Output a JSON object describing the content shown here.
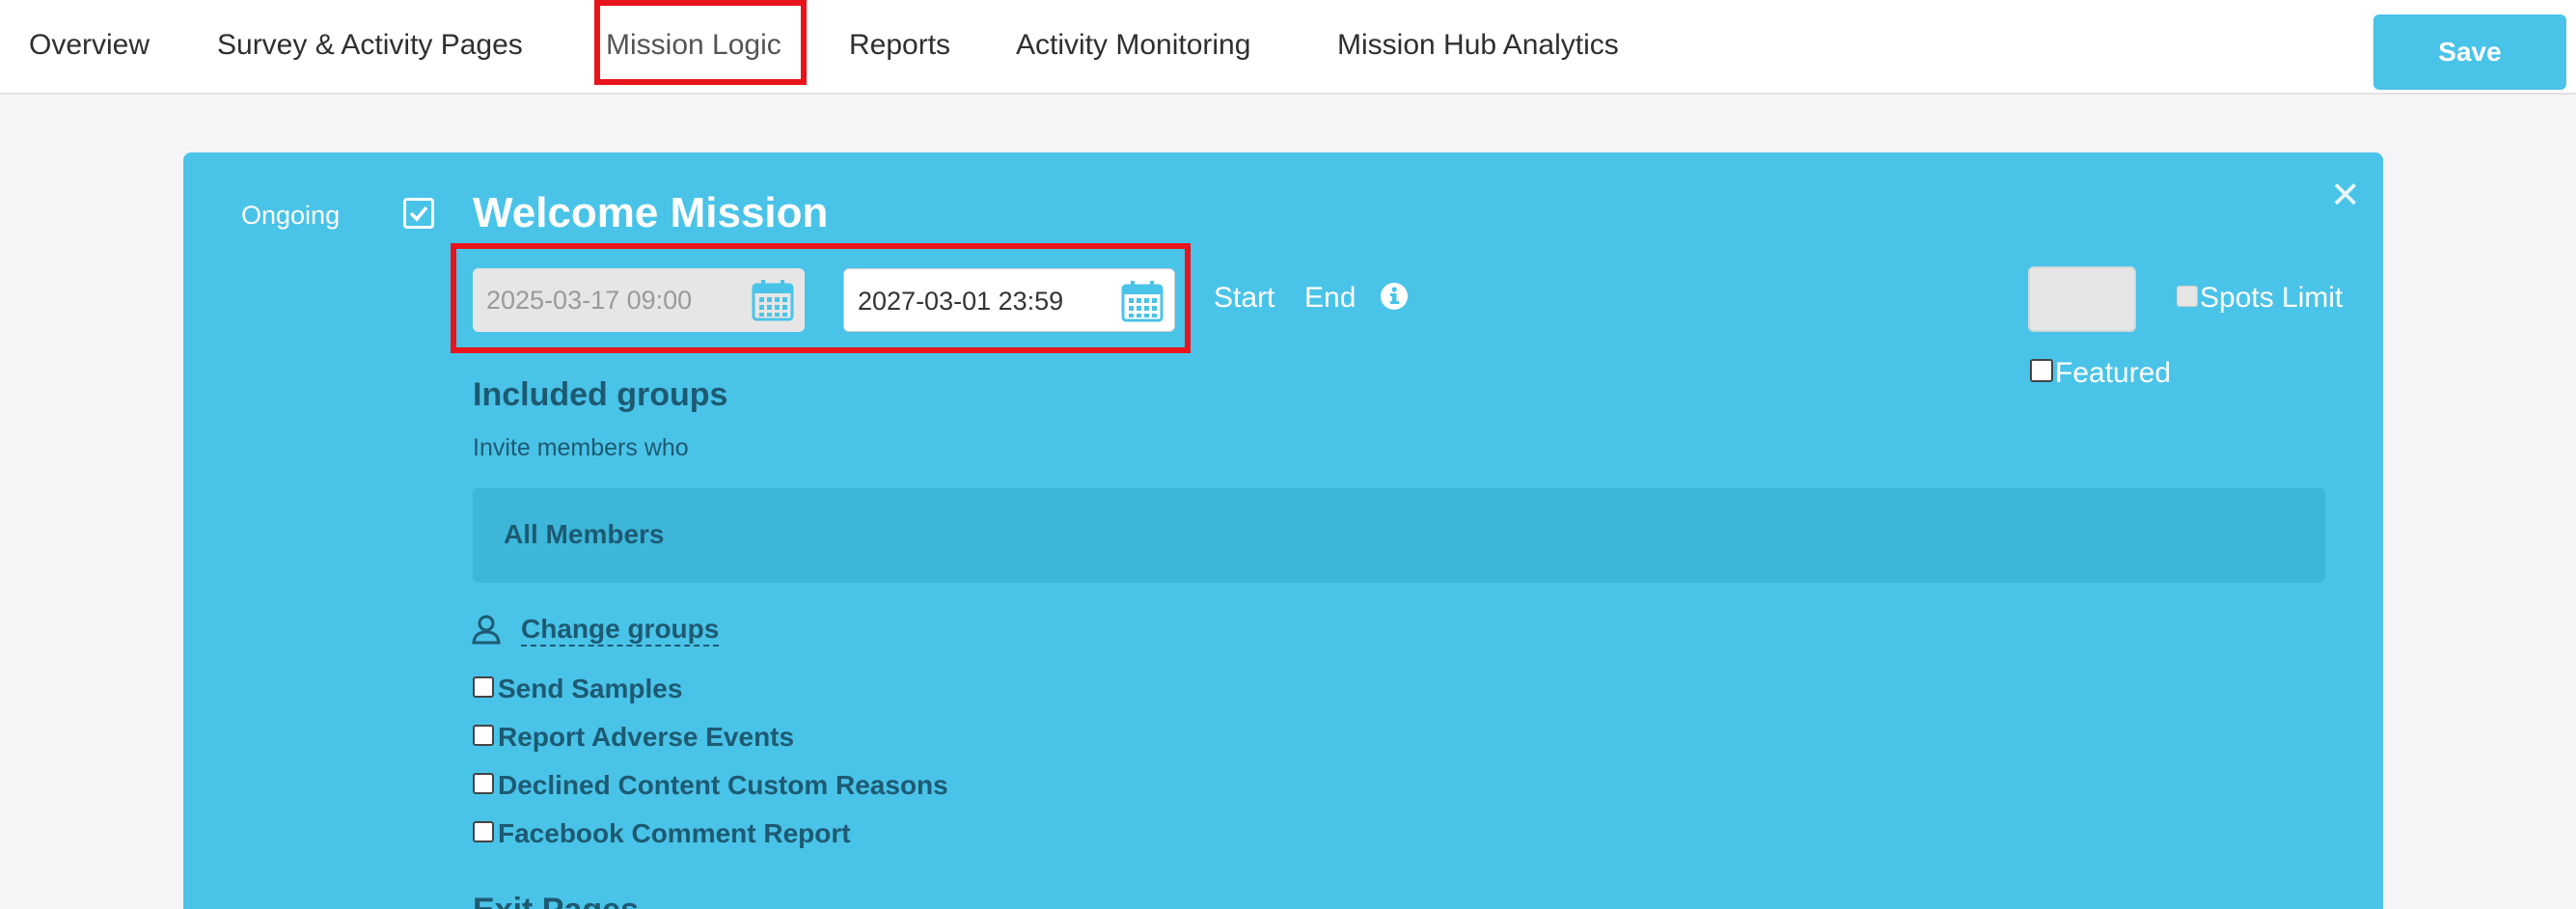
{
  "nav": {
    "tabs": [
      {
        "label": "Overview"
      },
      {
        "label": "Survey & Activity Pages"
      },
      {
        "label": "Mission Logic"
      },
      {
        "label": "Reports"
      },
      {
        "label": "Activity Monitoring"
      },
      {
        "label": "Mission Hub Analytics"
      }
    ],
    "active": "Mission Logic",
    "save_label": "Save"
  },
  "mission": {
    "ongoing_label": "Ongoing",
    "ongoing_checked": true,
    "title": "Welcome Mission",
    "start_date": "2025-03-17 09:00",
    "end_date": "2027-03-01 23:59",
    "start_label": "Start",
    "end_label": "End",
    "spots_limit_label": "Spots Limit",
    "spots_limit_value": "",
    "featured_label": "Featured",
    "included_groups_title": "Included groups",
    "invite_text": "Invite members who",
    "members_label": "All Members",
    "change_groups_label": "Change groups",
    "options": [
      {
        "label": "Send Samples",
        "checked": false
      },
      {
        "label": "Report Adverse Events",
        "checked": false
      },
      {
        "label": "Declined Content Custom Reasons",
        "checked": false
      },
      {
        "label": "Facebook Comment Report",
        "checked": false
      }
    ],
    "exit_pages_title": "Exit Pages"
  },
  "colors": {
    "card": "#4ac3e8",
    "highlight": "#e8141b",
    "text_dark": "#1d5a72"
  }
}
